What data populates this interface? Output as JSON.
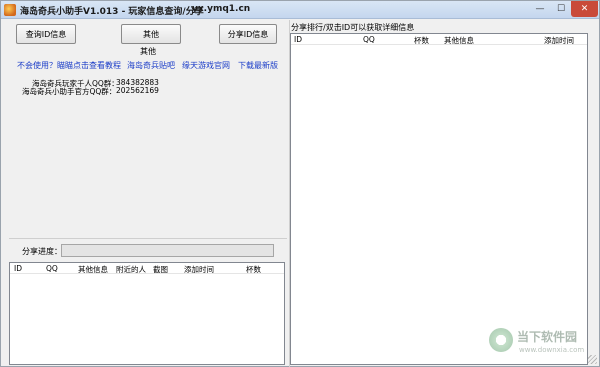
{
  "window": {
    "title": "海岛奇兵小助手V1.013 - 玩家信息查询/分享",
    "url_text": "yx.ymq1.cn",
    "minimize_glyph": "—",
    "maximize_glyph": "☐",
    "close_glyph": "✕"
  },
  "toolbar": {
    "query_id_label": "查询ID信息",
    "other_label": "其他",
    "share_id_label": "分享ID信息"
  },
  "other_group": {
    "label": "其他",
    "links": [
      "不会使用？瞄瞄点击查看教程",
      "海岛奇兵贴吧",
      "缘天游戏官网",
      "下载最新版"
    ],
    "player_qq_label": "海岛奇兵玩家千人QQ群：",
    "player_qq_value": "384382883",
    "official_qq_label": "海岛奇兵小助手官方QQ群：",
    "official_qq_value": "202562169"
  },
  "share_progress": {
    "label": "分享进度：",
    "value": 0
  },
  "left_list": {
    "columns": [
      "ID",
      "QQ",
      "其他信息",
      "附近的人",
      "截图",
      "添加时间",
      "杯数"
    ]
  },
  "right_panel": {
    "title": "分享排行/双击ID可以获取详细信息",
    "columns": [
      "ID",
      "QQ",
      "杯数",
      "其他信息",
      "添加时间"
    ]
  },
  "watermark": {
    "text": "当下软件园",
    "sub": "www.downxia.com"
  }
}
